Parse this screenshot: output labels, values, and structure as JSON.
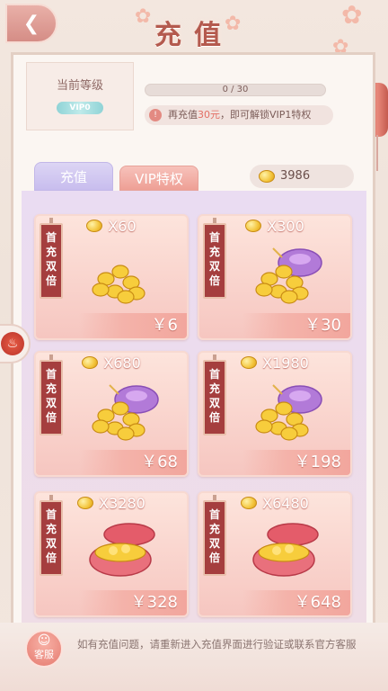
{
  "header": {
    "title": "充值",
    "back_icon": "back-fan-icon"
  },
  "level": {
    "label": "当前等级",
    "badge": "VIP0",
    "progress_text": "0 / 30",
    "progress_fraction": 0,
    "tip_prefix": "再充值",
    "tip_amount": "30元",
    "tip_suffix": "，即可解锁VIP1特权",
    "tip_icon": "!"
  },
  "tabs": {
    "charge": "充值",
    "vip": "VIP特权"
  },
  "balance": {
    "value": "3986"
  },
  "ribbon_text": "首充双倍",
  "products": [
    {
      "qty": "X60",
      "price": "￥6",
      "art": "coins"
    },
    {
      "qty": "X300",
      "price": "￥30",
      "art": "pouch-coins"
    },
    {
      "qty": "X680",
      "price": "￥68",
      "art": "pouch-coins"
    },
    {
      "qty": "X1980",
      "price": "￥198",
      "art": "pouch-coins"
    },
    {
      "qty": "X3280",
      "price": "￥328",
      "art": "chest"
    },
    {
      "qty": "X6480",
      "price": "￥648",
      "art": "chest"
    }
  ],
  "side_button": {
    "icon": "fire-icon"
  },
  "footer": {
    "service_label": "客服",
    "text": "如有充值问题，请重新进入充值界面进行验证或联系官方客服"
  },
  "colors": {
    "accent": "#e36f65",
    "title": "#b45a4e",
    "ribbon": "#a53e3e"
  }
}
